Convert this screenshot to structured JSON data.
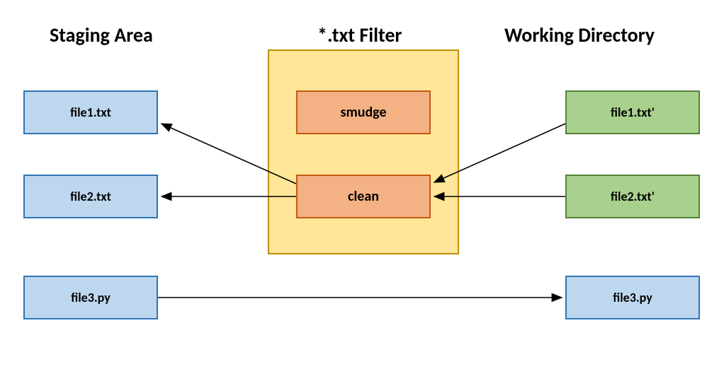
{
  "headings": {
    "staging": "Staging Area",
    "filter": "*.txt Filter",
    "working": "Working Directory"
  },
  "staging_files": {
    "file1": "file1.txt",
    "file2": "file2.txt",
    "file3": "file3.py"
  },
  "working_files": {
    "file1": "file1.txt'",
    "file2": "file2.txt'",
    "file3": "file3.py"
  },
  "filter_ops": {
    "smudge": "smudge",
    "clean": "clean"
  },
  "colors": {
    "blue_fill": "#bdd7ee",
    "blue_border": "#2e75b6",
    "green_fill": "#a9d18e",
    "green_border": "#548235",
    "filter_fill": "#ffe699",
    "filter_border": "#bf9000",
    "orange_fill": "#f4b183",
    "orange_border": "#c55a11"
  }
}
